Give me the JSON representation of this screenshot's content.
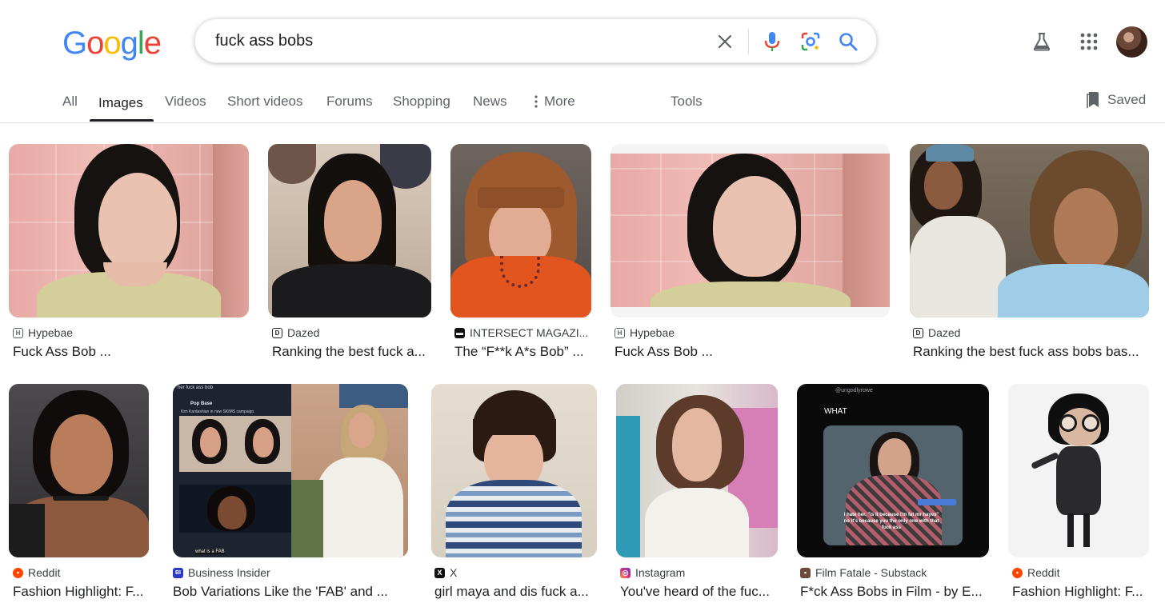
{
  "logo": {
    "letters": [
      "G",
      "o",
      "o",
      "g",
      "l",
      "e"
    ],
    "colors": [
      "#4285F4",
      "#EA4335",
      "#FBBC05",
      "#4285F4",
      "#34A853",
      "#EA4335"
    ]
  },
  "search": {
    "query": "fuck ass bobs"
  },
  "icons": {
    "clear": "close-icon",
    "voice": "microphone-icon",
    "lens": "lens-icon",
    "search": "search-icon",
    "labs": "flask-icon",
    "apps": "apps-grid-icon",
    "saved": "bookmark-icon"
  },
  "tabs": [
    {
      "label": "All"
    },
    {
      "label": "Images",
      "active": true
    },
    {
      "label": "Videos"
    },
    {
      "label": "Short videos"
    },
    {
      "label": "Forums"
    },
    {
      "label": "Shopping"
    },
    {
      "label": "News"
    },
    {
      "label": "More"
    },
    {
      "label": "Tools"
    }
  ],
  "saved_label": "Saved",
  "results": [
    {
      "source": "Hypebae",
      "favicon": "hypebae",
      "title": "Fuck Ass Bob ..."
    },
    {
      "source": "Dazed",
      "favicon": "dazed",
      "title": "Ranking the best fuck a..."
    },
    {
      "source": "INTERSECT MAGAZI...",
      "favicon": "intersect",
      "title": "The “F**k A*s Bob” ..."
    },
    {
      "source": "Hypebae",
      "favicon": "hypebae",
      "title": "Fuck Ass Bob ..."
    },
    {
      "source": "Dazed",
      "favicon": "dazed",
      "title": "Ranking the best fuck ass bobs bas..."
    },
    {
      "source": "Reddit",
      "favicon": "reddit",
      "title": "Fashion Highlight: F..."
    },
    {
      "source": "Business Insider",
      "favicon": "bi",
      "title": "Bob Variations Like the 'FAB' and ..."
    },
    {
      "source": "X",
      "favicon": "x",
      "title": "girl maya and dis fuck a..."
    },
    {
      "source": "Instagram",
      "favicon": "instagram",
      "title": "You've heard of the fuc..."
    },
    {
      "source": "Film Fatale - Substack",
      "favicon": "substack",
      "title": "F*ck Ass Bobs in Film - by E..."
    },
    {
      "source": "Reddit",
      "favicon": "reddit",
      "title": "Fashion Highlight: F..."
    }
  ],
  "thumb_text": {
    "tweet_header": "her fuck ass bob",
    "tweet_user": "Pop Base",
    "tweet_body": "Kim Kardashian in new SKIMS campaign.",
    "tweet_caption": "what is a FAB",
    "ff_handle": "@ungodlyrowe",
    "ff_what": "WHAT",
    "ff_caption": "i hate her. \"is it because i'm fat mr hayes\" no it's because you the only one with that fuck ass"
  }
}
